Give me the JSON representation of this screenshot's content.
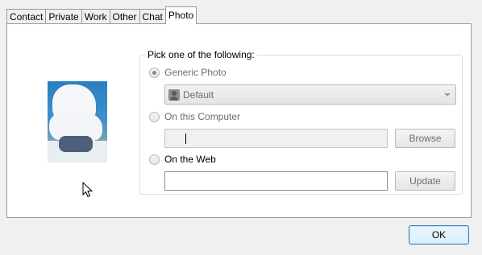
{
  "tabs": [
    {
      "label": "Contact",
      "active": false
    },
    {
      "label": "Private",
      "active": false
    },
    {
      "label": "Work",
      "active": false
    },
    {
      "label": "Other",
      "active": false
    },
    {
      "label": "Chat",
      "active": false
    },
    {
      "label": "Photo",
      "active": true
    }
  ],
  "group": {
    "legend": "Pick one of the following:",
    "options": {
      "generic": {
        "label": "Generic Photo",
        "checked": true
      },
      "computer": {
        "label": "On this Computer",
        "checked": false
      },
      "web": {
        "label": "On the Web",
        "checked": false
      }
    },
    "generic_select": {
      "value": "Default",
      "icon": "person-silhouette-icon"
    },
    "computer_path": {
      "value": ""
    },
    "web_url": {
      "value": ""
    },
    "browse_label": "Browse",
    "update_label": "Update"
  },
  "footer": {
    "ok_label": "OK"
  }
}
